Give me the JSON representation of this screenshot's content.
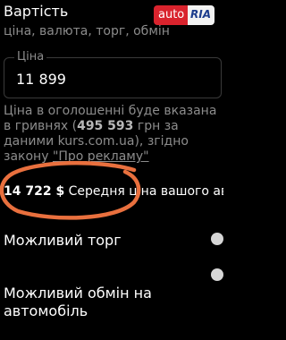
{
  "header": {
    "title": "Вартість",
    "subtitle": "ціна, валюта, торг, обмін"
  },
  "logo": {
    "part1": "auto",
    "part2": "RIA"
  },
  "price_field": {
    "label": "Ціна",
    "value": "11 899"
  },
  "note": {
    "text1": "Ціна в оголошенні буде вказана в гривнях (",
    "amount": "495 593",
    "text2": " грн за даними kurs.com.ua), згідно закону ",
    "link": "\"Про рекламу\""
  },
  "average": {
    "value": "14 722 $",
    "label": " Середня ціна вашого авто"
  },
  "options": {
    "torg_label": "Можливий торг",
    "obmin_label": "Можливий обмін на автомобіль"
  },
  "colors": {
    "background": "#000000",
    "muted_text": "#8c8c8c",
    "annotation": "#e9703e",
    "logo_red": "#d9232d"
  }
}
